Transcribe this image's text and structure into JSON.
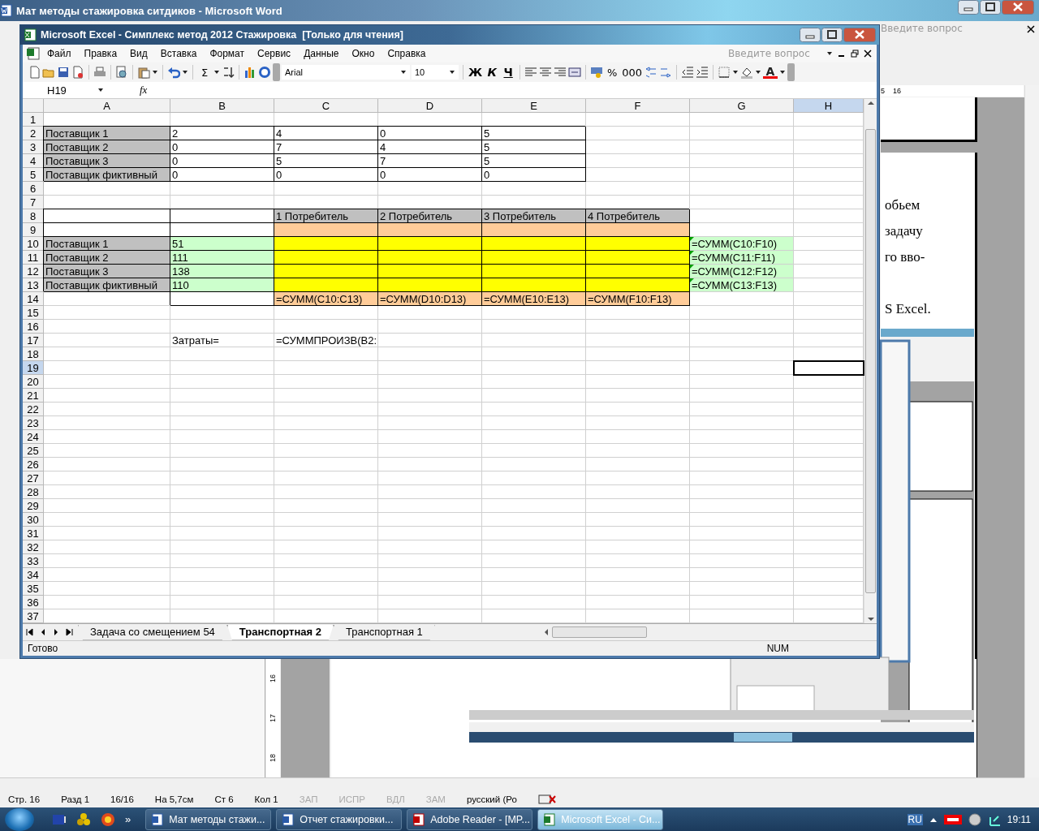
{
  "word": {
    "title": "Мат методы стажировка ситдиков - Microsoft Word",
    "help_placeholder": "Введите вопрос",
    "ruler": [
      "5",
      "16"
    ],
    "page_lines": [
      "обьем",
      "задачу",
      "го вво-",
      "S Excel."
    ],
    "vertical_ruler": [
      "16",
      "17",
      "18"
    ],
    "status_bar": [
      {
        "text": "Стр. 16",
        "disabled": false
      },
      {
        "text": "Разд 1",
        "disabled": false
      },
      {
        "text": "16/16",
        "disabled": false
      },
      {
        "text": "На 5,7см",
        "disabled": false
      },
      {
        "text": "Ст 6",
        "disabled": false
      },
      {
        "text": "Кол 1",
        "disabled": false
      },
      {
        "text": "ЗАП",
        "disabled": true
      },
      {
        "text": "ИСПР",
        "disabled": true
      },
      {
        "text": "ВДЛ",
        "disabled": true
      },
      {
        "text": "ЗАМ",
        "disabled": true
      },
      {
        "text": "русский (Ро",
        "disabled": false
      }
    ]
  },
  "excel": {
    "title": "Microsoft Excel - Симплекс метод 2012 Стажировка  [Только для чтения]",
    "menu": [
      "Файл",
      "Правка",
      "Вид",
      "Вставка",
      "Формат",
      "Сервис",
      "Данные",
      "Окно",
      "Справка"
    ],
    "help_placeholder": "Введите вопрос",
    "toolbar": [
      {
        "kind": "icon"
      },
      {
        "kind": "icon"
      },
      {
        "kind": "icon"
      },
      {
        "kind": "icon"
      },
      {
        "kind": "sep"
      },
      {
        "kind": "icon"
      },
      {
        "kind": "sep"
      },
      {
        "kind": "icon"
      },
      {
        "kind": "sep"
      },
      {
        "kind": "icon"
      },
      {
        "kind": "caret"
      },
      {
        "kind": "sep"
      },
      {
        "kind": "icon"
      },
      {
        "kind": "caret"
      },
      {
        "kind": "sep"
      },
      {
        "kind": "glyph",
        "label": "Σ"
      },
      {
        "kind": "caret"
      },
      {
        "kind": "icon"
      },
      {
        "kind": "sep"
      },
      {
        "kind": "icon"
      },
      {
        "kind": "icon"
      },
      {
        "kind": "grip"
      },
      {
        "kind": "font",
        "label": "Arial"
      },
      {
        "kind": "size",
        "label": "10"
      },
      {
        "kind": "sep"
      },
      {
        "kind": "bold",
        "label": "Ж"
      },
      {
        "kind": "italic",
        "label": "К"
      },
      {
        "kind": "underline",
        "label": "Ч"
      },
      {
        "kind": "sep"
      },
      {
        "kind": "icon"
      },
      {
        "kind": "icon"
      },
      {
        "kind": "icon"
      },
      {
        "kind": "icon"
      },
      {
        "kind": "sep"
      },
      {
        "kind": "icon"
      },
      {
        "kind": "glyph",
        "label": "%"
      },
      {
        "kind": "glyph",
        "label": "000"
      },
      {
        "kind": "icon"
      },
      {
        "kind": "icon"
      },
      {
        "kind": "sep"
      },
      {
        "kind": "icon"
      },
      {
        "kind": "icon"
      },
      {
        "kind": "sep"
      },
      {
        "kind": "icon"
      },
      {
        "kind": "caret"
      },
      {
        "kind": "icon"
      },
      {
        "kind": "caret"
      },
      {
        "kind": "fontcolor",
        "label": "A"
      },
      {
        "kind": "caret"
      },
      {
        "kind": "grip"
      }
    ],
    "name_box": "H19",
    "fx": "fx",
    "columns": [
      {
        "label": "A",
        "selected": false
      },
      {
        "label": "B",
        "selected": false
      },
      {
        "label": "C",
        "selected": false
      },
      {
        "label": "D",
        "selected": false
      },
      {
        "label": "E",
        "selected": false
      },
      {
        "label": "F",
        "selected": false
      },
      {
        "label": "G",
        "selected": false
      },
      {
        "label": "H",
        "selected": true
      }
    ],
    "rows": [
      {
        "number": "1",
        "selected": false
      },
      {
        "number": "2",
        "selected": false,
        "cells": [
          {
            "text": "Поставщик 1",
            "color": "#c0c0c0",
            "bordered": true,
            "flagged": false
          },
          {
            "text": "2",
            "color": "#ffffff",
            "bordered": true,
            "flagged": false
          },
          {
            "text": "4",
            "color": "#ffffff",
            "bordered": true,
            "flagged": false
          },
          {
            "text": "0",
            "color": "#ffffff",
            "bordered": true,
            "flagged": false
          },
          {
            "text": "5",
            "color": "#ffffff",
            "bordered": true,
            "flagged": false
          }
        ]
      },
      {
        "number": "3",
        "selected": false,
        "cells": [
          {
            "text": "Поставщик 2",
            "color": "#c0c0c0",
            "bordered": true,
            "flagged": false
          },
          {
            "text": "0",
            "color": "#ffffff",
            "bordered": true,
            "flagged": false
          },
          {
            "text": "7",
            "color": "#ffffff",
            "bordered": true,
            "flagged": false
          },
          {
            "text": "4",
            "color": "#ffffff",
            "bordered": true,
            "flagged": false
          },
          {
            "text": "5",
            "color": "#ffffff",
            "bordered": true,
            "flagged": false
          }
        ]
      },
      {
        "number": "4",
        "selected": false,
        "cells": [
          {
            "text": "Поставщик 3",
            "color": "#c0c0c0",
            "bordered": true,
            "flagged": false
          },
          {
            "text": "0",
            "color": "#ffffff",
            "bordered": true,
            "flagged": false
          },
          {
            "text": "5",
            "color": "#ffffff",
            "bordered": true,
            "flagged": false
          },
          {
            "text": "7",
            "color": "#ffffff",
            "bordered": true,
            "flagged": false
          },
          {
            "text": "5",
            "color": "#ffffff",
            "bordered": true,
            "flagged": false
          }
        ]
      },
      {
        "number": "5",
        "selected": false,
        "cells": [
          {
            "text": "Поставщик фиктивный",
            "color": "#c0c0c0",
            "bordered": true,
            "flagged": false
          },
          {
            "text": "0",
            "color": "#ffffff",
            "bordered": true,
            "flagged": false
          },
          {
            "text": "0",
            "color": "#ffffff",
            "bordered": true,
            "flagged": false
          },
          {
            "text": "0",
            "color": "#ffffff",
            "bordered": true,
            "flagged": false
          },
          {
            "text": "0",
            "color": "#ffffff",
            "bordered": true,
            "flagged": false
          }
        ]
      },
      {
        "number": "6",
        "selected": false
      },
      {
        "number": "7",
        "selected": false
      },
      {
        "number": "8",
        "selected": false,
        "cells": [
          {
            "color": "#ffffff",
            "bordered": true,
            "flagged": false
          },
          {
            "color": "#ffffff",
            "bordered": true,
            "flagged": false
          },
          {
            "text": "1 Потребитель",
            "color": "#c0c0c0",
            "bordered": true,
            "flagged": false
          },
          {
            "text": "2 Потребитель",
            "color": "#c0c0c0",
            "bordered": true,
            "flagged": false
          },
          {
            "text": "3 Потребитель",
            "color": "#c0c0c0",
            "bordered": true,
            "flagged": false
          },
          {
            "text": "4 Потребитель",
            "color": "#c0c0c0",
            "bordered": true,
            "flagged": false
          }
        ]
      },
      {
        "number": "9",
        "selected": false,
        "cells": [
          {
            "color": "#ffffff",
            "bordered": true,
            "flagged": false
          },
          {
            "color": "#ffffff",
            "bordered": true,
            "flagged": false
          },
          {
            "color": "#ffcc99",
            "bordered": true,
            "flagged": false
          },
          {
            "color": "#ffcc99",
            "bordered": true,
            "flagged": false
          },
          {
            "color": "#ffcc99",
            "bordered": true,
            "flagged": false
          },
          {
            "color": "#ffcc99",
            "bordered": true,
            "flagged": false
          }
        ]
      },
      {
        "number": "10",
        "selected": false,
        "cells": [
          {
            "text": "Поставщик 1",
            "color": "#c0c0c0",
            "bordered": true,
            "flagged": false
          },
          {
            "text": "51",
            "color": "#ccffcc",
            "bordered": true,
            "flagged": false
          },
          {
            "color": "#ffff00",
            "bordered": true,
            "flagged": false
          },
          {
            "color": "#ffff00",
            "bordered": true,
            "flagged": false
          },
          {
            "color": "#ffff00",
            "bordered": true,
            "flagged": false
          },
          {
            "color": "#ffff00",
            "bordered": true,
            "flagged": false
          },
          {
            "text": "=СУММ(C10:F10)",
            "color": "#ccffcc",
            "bordered": false,
            "flagged": true
          }
        ]
      },
      {
        "number": "11",
        "selected": false,
        "cells": [
          {
            "text": "Поставщик 2",
            "color": "#c0c0c0",
            "bordered": true,
            "flagged": false
          },
          {
            "text": "111",
            "color": "#ccffcc",
            "bordered": true,
            "flagged": false
          },
          {
            "color": "#ffff00",
            "bordered": true,
            "flagged": false
          },
          {
            "color": "#ffff00",
            "bordered": true,
            "flagged": false
          },
          {
            "color": "#ffff00",
            "bordered": true,
            "flagged": false
          },
          {
            "color": "#ffff00",
            "bordered": true,
            "flagged": false
          },
          {
            "text": "=СУММ(C11:F11)",
            "color": "#ccffcc",
            "bordered": false,
            "flagged": true
          }
        ]
      },
      {
        "number": "12",
        "selected": false,
        "cells": [
          {
            "text": "Поставщик 3",
            "color": "#c0c0c0",
            "bordered": true,
            "flagged": false
          },
          {
            "text": "138",
            "color": "#ccffcc",
            "bordered": true,
            "flagged": false
          },
          {
            "color": "#ffff00",
            "bordered": true,
            "flagged": false
          },
          {
            "color": "#ffff00",
            "bordered": true,
            "flagged": false
          },
          {
            "color": "#ffff00",
            "bordered": true,
            "flagged": false
          },
          {
            "color": "#ffff00",
            "bordered": true,
            "flagged": false
          },
          {
            "text": "=СУММ(C12:F12)",
            "color": "#ccffcc",
            "bordered": false,
            "flagged": true
          }
        ]
      },
      {
        "number": "13",
        "selected": false,
        "cells": [
          {
            "text": "Поставщик фиктивный",
            "color": "#c0c0c0",
            "bordered": true,
            "flagged": false
          },
          {
            "text": "110",
            "color": "#ccffcc",
            "bordered": true,
            "flagged": false
          },
          {
            "color": "#ffff00",
            "bordered": true,
            "flagged": false
          },
          {
            "color": "#ffff00",
            "bordered": true,
            "flagged": false
          },
          {
            "color": "#ffff00",
            "bordered": true,
            "flagged": false
          },
          {
            "color": "#ffff00",
            "bordered": true,
            "flagged": false
          },
          {
            "text": "=СУММ(C13:F13)",
            "color": "#ccffcc",
            "bordered": false,
            "flagged": true
          }
        ]
      },
      {
        "number": "14",
        "selected": false,
        "cells": [
          {
            "color": "#ffffff",
            "bordered": false,
            "flagged": false
          },
          {
            "color": "#ffffff",
            "bordered": true,
            "flagged": false
          },
          {
            "text": "=СУММ(C10:C13)",
            "color": "#ffcc99",
            "bordered": true,
            "flagged": false
          },
          {
            "text": "=СУММ(D10:D13)",
            "color": "#ffcc99",
            "bordered": true,
            "flagged": false
          },
          {
            "text": "=СУММ(E10:E13)",
            "color": "#ffcc99",
            "bordered": true,
            "flagged": false
          },
          {
            "text": "=СУММ(F10:F13)",
            "color": "#ffcc99",
            "bordered": true,
            "flagged": false
          }
        ]
      },
      {
        "number": "15",
        "selected": false
      },
      {
        "number": "16",
        "selected": false
      },
      {
        "number": "17",
        "selected": false,
        "cells": [
          {
            "color": "#ffffff",
            "bordered": false,
            "flagged": false
          },
          {
            "text": "Затраты=",
            "color": "#ffffff",
            "bordered": false,
            "flagged": false
          },
          {
            "text": "=СУММПРОИЗВ(B2:",
            "color": "#ffffff",
            "bordered": false,
            "flagged": false
          }
        ]
      },
      {
        "number": "18",
        "selected": false
      },
      {
        "number": "19",
        "selected": true
      },
      {
        "number": "20",
        "selected": false
      },
      {
        "number": "21",
        "selected": false
      },
      {
        "number": "22",
        "selected": false
      },
      {
        "number": "23",
        "selected": false
      },
      {
        "number": "24",
        "selected": false
      },
      {
        "number": "25",
        "selected": false
      },
      {
        "number": "26",
        "selected": false
      },
      {
        "number": "27",
        "selected": false
      },
      {
        "number": "28",
        "selected": false
      },
      {
        "number": "29",
        "selected": false
      },
      {
        "number": "30",
        "selected": false
      },
      {
        "number": "31",
        "selected": false
      },
      {
        "number": "32",
        "selected": false
      },
      {
        "number": "33",
        "selected": false
      },
      {
        "number": "34",
        "selected": false
      },
      {
        "number": "35",
        "selected": false
      },
      {
        "number": "36",
        "selected": false
      },
      {
        "number": "37",
        "selected": false
      }
    ],
    "sheet_tabs": [
      {
        "label": "Задача со смещением 54",
        "selected": false
      },
      {
        "label": "Транспортная 2",
        "selected": true
      },
      {
        "label": "Транспортная 1",
        "selected": false
      }
    ],
    "status": "Готово",
    "indicator": "NUM"
  },
  "taskbar": {
    "more": "»",
    "tasks": [
      {
        "label": "Мат методы стажи...",
        "selected": false
      },
      {
        "label": "Отчет стажировки...",
        "selected": false
      },
      {
        "label": "Adobe Reader - [MP...",
        "selected": false
      },
      {
        "label": "Microsoft Excel - Си...",
        "selected": true
      }
    ],
    "language": "RU",
    "time": "19:11"
  }
}
